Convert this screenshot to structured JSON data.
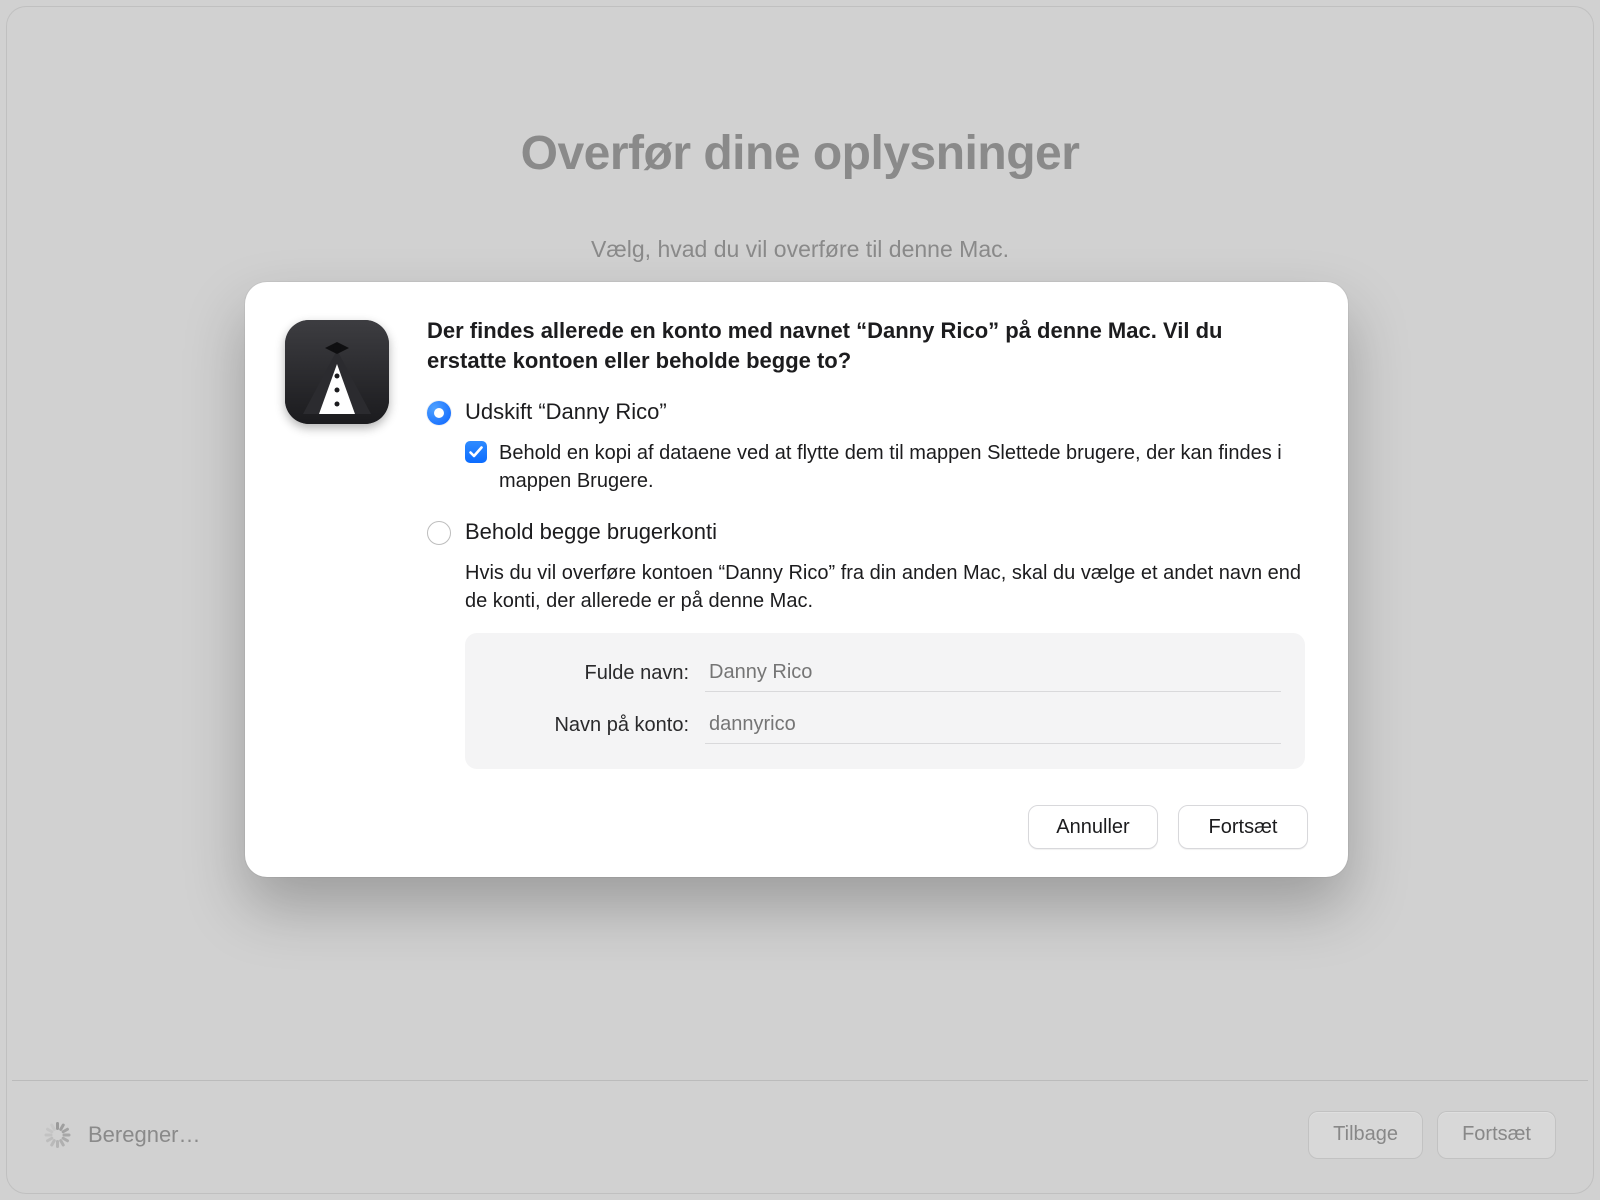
{
  "background": {
    "title": "Overfør dine oplysninger",
    "subtitle": "Vælg, hvad du vil overføre til denne Mac."
  },
  "footer": {
    "status": "Beregner…",
    "back_label": "Tilbage",
    "continue_label": "Fortsæt"
  },
  "modal": {
    "title": "Der findes allerede en konto med navnet “Danny Rico” på denne Mac. Vil du erstatte kontoen eller beholde begge to?",
    "option_replace_label": "Udskift “Danny Rico”",
    "replace_keep_copy_text": "Behold en kopi af dataene ved at flytte dem til mappen Slettede brugere, der kan findes i mappen Brugere.",
    "option_keep_both_label": "Behold begge brugerkonti",
    "keep_both_description": "Hvis du vil overføre kontoen “Danny Rico” fra din anden Mac, skal du vælge et andet navn end de konti, der allerede er på denne Mac.",
    "fields": {
      "full_name_label": "Fulde navn:",
      "full_name_placeholder": "Danny Rico",
      "account_name_label": "Navn på konto:",
      "account_name_placeholder": "dannyrico"
    },
    "cancel_label": "Annuller",
    "continue_label": "Fortsæt"
  },
  "colors": {
    "accent": "#0a63ff"
  }
}
